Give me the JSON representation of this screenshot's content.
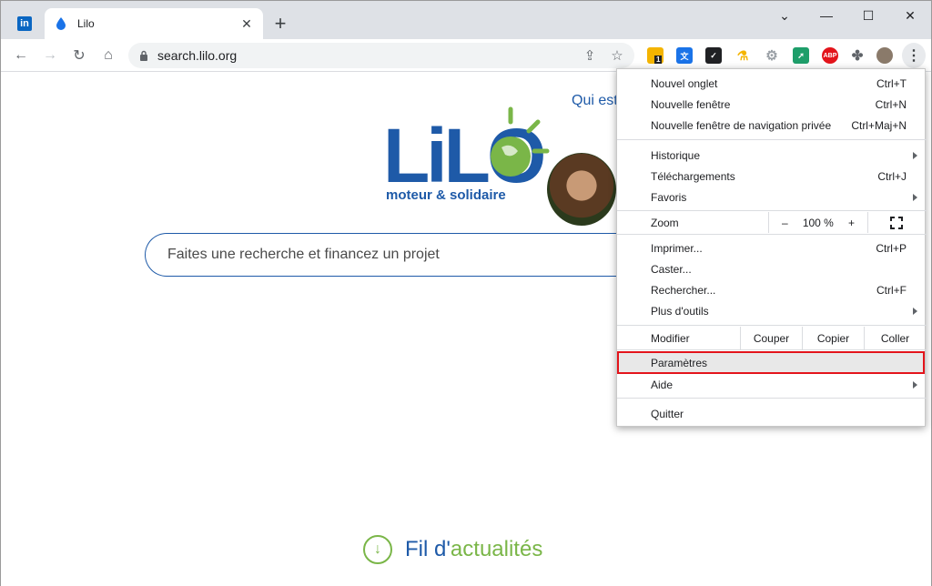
{
  "tabs": [
    {
      "label": "",
      "icon": "linkedin-icon"
    },
    {
      "label": "Lilo",
      "icon": "lilo-drop-icon",
      "active": true
    }
  ],
  "linkedin_glyph": "in",
  "omnibox": {
    "url": "search.lilo.org"
  },
  "page": {
    "qui_est": "Qui est",
    "logo_text": "LiLO",
    "slogan": "moteur & solidaire",
    "search_placeholder": "Faites une recherche et financez un projet",
    "news_part1": "Fil d'",
    "news_part2": "actualités"
  },
  "menu": {
    "new_tab": {
      "label": "Nouvel onglet",
      "shortcut": "Ctrl+T"
    },
    "new_window": {
      "label": "Nouvelle fenêtre",
      "shortcut": "Ctrl+N"
    },
    "incognito": {
      "label": "Nouvelle fenêtre de navigation privée",
      "shortcut": "Ctrl+Maj+N"
    },
    "history": {
      "label": "Historique"
    },
    "downloads": {
      "label": "Téléchargements",
      "shortcut": "Ctrl+J"
    },
    "bookmarks": {
      "label": "Favoris"
    },
    "zoom": {
      "label": "Zoom",
      "minus": "–",
      "value": "100 %",
      "plus": "+"
    },
    "print": {
      "label": "Imprimer...",
      "shortcut": "Ctrl+P"
    },
    "cast": {
      "label": "Caster..."
    },
    "find": {
      "label": "Rechercher...",
      "shortcut": "Ctrl+F"
    },
    "more_tools": {
      "label": "Plus d'outils"
    },
    "edit": {
      "label": "Modifier",
      "cut": "Couper",
      "copy": "Copier",
      "paste": "Coller"
    },
    "settings": {
      "label": "Paramètres"
    },
    "help": {
      "label": "Aide"
    },
    "quit": {
      "label": "Quitter"
    }
  },
  "extensions": [
    {
      "name": "ext-badge-icon",
      "badge": "1",
      "color": "#f4b400"
    },
    {
      "name": "translate-icon",
      "color": "#1a73e8"
    },
    {
      "name": "checkmark-ext-icon",
      "color": "#202124"
    },
    {
      "name": "flask-icon",
      "color": "#f4b400"
    },
    {
      "name": "gear-ext-icon",
      "color": "#9aa0a6"
    },
    {
      "name": "arrow-ext-icon",
      "color": "#1e9e6a"
    },
    {
      "name": "adblock-icon",
      "label": "ABP",
      "color": "#e3141b"
    },
    {
      "name": "puzzle-icon",
      "color": "#5f6368"
    }
  ],
  "colors": {
    "brand_blue": "#1e5aa8",
    "brand_green": "#7ab648",
    "highlight_border": "#e3141b"
  }
}
